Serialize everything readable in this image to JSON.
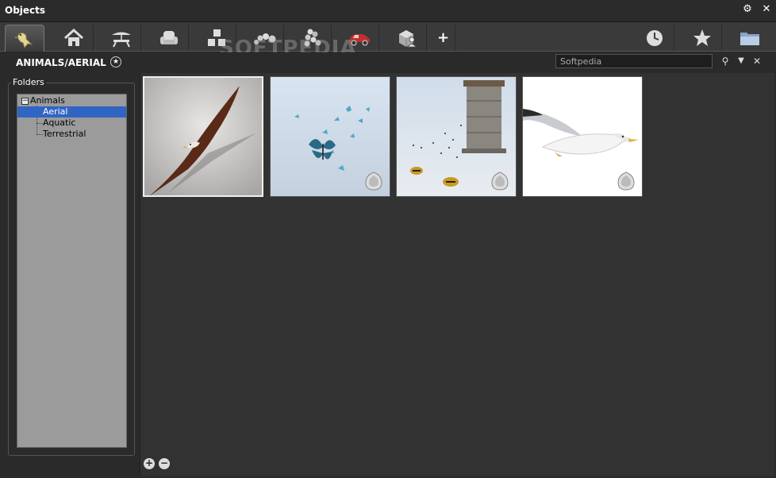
{
  "window": {
    "title": "Objects"
  },
  "tabs": [
    {
      "name": "tab-animals",
      "icon": "bird-icon"
    },
    {
      "name": "tab-home",
      "icon": "house-icon"
    },
    {
      "name": "tab-outdoor",
      "icon": "picnic-table-icon"
    },
    {
      "name": "tab-furniture",
      "icon": "armchair-icon"
    },
    {
      "name": "tab-shapes",
      "icon": "blocks-icon"
    },
    {
      "name": "tab-particles",
      "icon": "spheres-icon"
    },
    {
      "name": "tab-groups",
      "icon": "sphere-cluster-icon"
    },
    {
      "name": "tab-vehicles",
      "icon": "car-icon"
    },
    {
      "name": "tab-user-objects",
      "icon": "cube-user-icon"
    },
    {
      "name": "tab-add",
      "icon": "plus-icon",
      "label": "+"
    }
  ],
  "right_tabs": [
    {
      "name": "tab-recent",
      "icon": "clock-icon"
    },
    {
      "name": "tab-favorites",
      "icon": "star-icon"
    },
    {
      "name": "tab-folder",
      "icon": "folder-icon"
    }
  ],
  "watermark": "SOFTPEDIA",
  "path": {
    "label": "ANIMALS/AERIAL",
    "fav_glyph": "★"
  },
  "search": {
    "value": "Softpedia"
  },
  "search_buttons": {
    "search": "⚲",
    "dropdown": "▼",
    "clear": "✕"
  },
  "folders": {
    "legend": "Folders",
    "root": {
      "label": "Animals",
      "toggle": "−"
    },
    "children": [
      {
        "label": "Aerial",
        "selected": true
      },
      {
        "label": "Aquatic",
        "selected": false
      },
      {
        "label": "Terrestrial",
        "selected": false
      }
    ]
  },
  "thumbnails": [
    {
      "name": "eagle",
      "selected": true,
      "badge": false
    },
    {
      "name": "butterflies",
      "selected": false,
      "badge": true
    },
    {
      "name": "bees",
      "selected": false,
      "badge": true
    },
    {
      "name": "seagull",
      "selected": false,
      "badge": true
    }
  ],
  "bottom_buttons": {
    "add": "+",
    "remove": "−"
  },
  "titlebar_buttons": {
    "settings": "⚙",
    "close": "✕"
  }
}
